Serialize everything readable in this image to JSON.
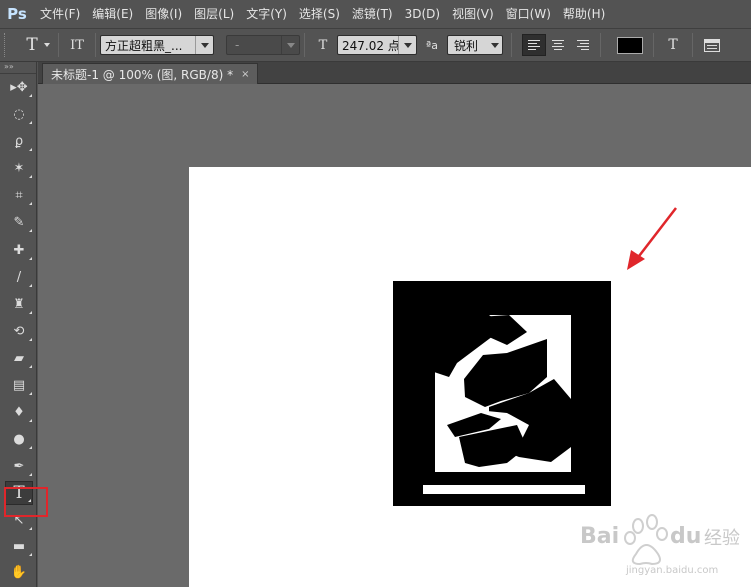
{
  "app": {
    "logo": "Ps",
    "menus": [
      "文件(F)",
      "编辑(E)",
      "图像(I)",
      "图层(L)",
      "文字(Y)",
      "选择(S)",
      "滤镜(T)",
      "3D(D)",
      "视图(V)",
      "窗口(W)",
      "帮助(H)"
    ]
  },
  "options": {
    "tool_glyph": "T",
    "orient_glyph": "IT",
    "font_family": "方正超粗黑_...",
    "font_style": "-",
    "size_glyph": "T",
    "font_size": "247.02 点",
    "aa_glyph": "ªa",
    "antialias": "锐利",
    "color": "#000000",
    "warp_glyph": "T"
  },
  "tools": {
    "toolbox_header": "»»",
    "items": [
      {
        "name": "move-tool",
        "glyph": "▸✥"
      },
      {
        "name": "marquee-tool",
        "glyph": "◌"
      },
      {
        "name": "lasso-tool",
        "glyph": "ϼ"
      },
      {
        "name": "magic-wand-tool",
        "glyph": "✶"
      },
      {
        "name": "crop-tool",
        "glyph": "⌗"
      },
      {
        "name": "eyedropper-tool",
        "glyph": "✎"
      },
      {
        "name": "healing-brush-tool",
        "glyph": "✚"
      },
      {
        "name": "brush-tool",
        "glyph": "/"
      },
      {
        "name": "clone-stamp-tool",
        "glyph": "♜"
      },
      {
        "name": "history-brush-tool",
        "glyph": "⟲"
      },
      {
        "name": "eraser-tool",
        "glyph": "▰"
      },
      {
        "name": "gradient-tool",
        "glyph": "▤"
      },
      {
        "name": "blur-tool",
        "glyph": "♦"
      },
      {
        "name": "dodge-tool",
        "glyph": "●"
      },
      {
        "name": "pen-tool",
        "glyph": "✒"
      },
      {
        "name": "type-tool",
        "glyph": "T"
      },
      {
        "name": "path-selection-tool",
        "glyph": "↖"
      },
      {
        "name": "rectangle-tool",
        "glyph": "▬"
      },
      {
        "name": "hand-tool",
        "glyph": "✋"
      }
    ]
  },
  "document": {
    "tab_title": "未标题-1 @ 100% (图, RGB/8) *",
    "close_glyph": "×",
    "canvas_glyph": "图"
  },
  "annotation": {
    "arrow_color": "#e0262b",
    "highlight_color": "#e0262b"
  },
  "watermark": {
    "brand_baidu": "Bai",
    "brand_du": "du",
    "brand_jingyan": "经验",
    "url": "jingyan.baidu.com"
  }
}
